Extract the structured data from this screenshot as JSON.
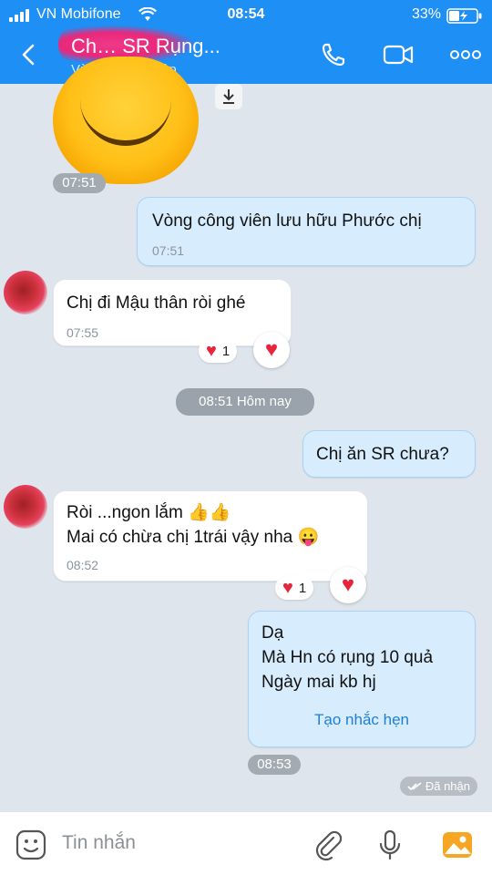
{
  "status_bar": {
    "carrier": "VN Mobifone",
    "time": "08:54",
    "battery": "33%"
  },
  "header": {
    "title": "Ch… SR Rụng...",
    "subtitle": "Vừa mới truy cập",
    "icons": [
      "back-icon",
      "phone-icon",
      "video-call-icon",
      "more-icon"
    ]
  },
  "messages": {
    "sticker_time": "07:51",
    "m1": {
      "text": "Vòng công viên lưu hữu Phước chị",
      "time": "07:51"
    },
    "m2": {
      "text": "Chị đi Mậu thân ròi ghé",
      "time": "07:55",
      "reaction_count": "1"
    },
    "date_divider": "08:51 Hôm nay",
    "m3": {
      "text": "Chị ăn SR chưa?"
    },
    "m4": {
      "line1": "Ròi ...ngon lắm 👍👍",
      "line2": "Mai có chừa chị 1trái vậy nha 😛",
      "time": "08:52",
      "reaction_count": "1"
    },
    "m5": {
      "line1": "Dạ",
      "line2": "Mà Hn có rụng 10 quả",
      "line3": "Ngày mai kb hj",
      "action": "Tạo nhắc hẹn",
      "time": "08:53"
    },
    "status": "Đã nhận"
  },
  "input_bar": {
    "placeholder": "Tin nhắn",
    "icons": [
      "emoji-icon",
      "attach-icon",
      "mic-icon",
      "gallery-icon"
    ]
  },
  "colors": {
    "header": "#1e8ff5",
    "background": "#dfe5ec",
    "outgoing_bubble": "#d7edfd",
    "incoming_bubble": "#ffffff",
    "heart": "#e8243c",
    "link": "#1e7fd6"
  }
}
